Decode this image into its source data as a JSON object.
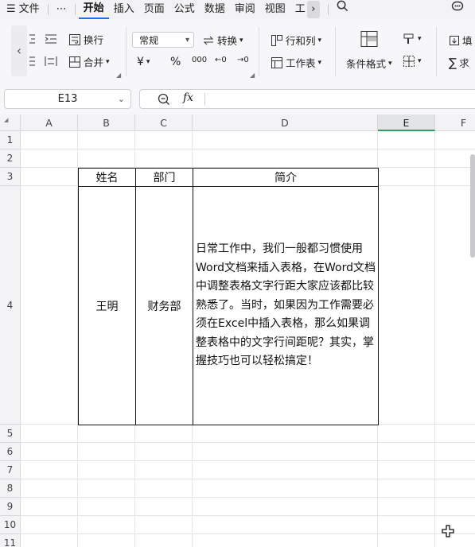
{
  "menu": {
    "items": [
      "文件",
      "开始",
      "插入",
      "页面",
      "公式",
      "数据",
      "审阅",
      "视图",
      "工"
    ],
    "active": "开始",
    "more": "⋯"
  },
  "ribbon": {
    "wrap_label": "换行",
    "merge_label": "合并",
    "number_format": "常规",
    "convert_label": "转换",
    "currency_symbol": "¥",
    "percent_symbol": "%",
    "thousands_symbol": "000",
    "dec_inc": "←0",
    "dec_dec": "→0",
    "rows_cols_label": "行和列",
    "sheet_label": "工作表",
    "cond_format_label": "条件格式",
    "fill_label": "填",
    "sum_label": "求"
  },
  "formula_bar": {
    "cell_ref": "E13",
    "fx": "fx",
    "value": ""
  },
  "sheet": {
    "columns": [
      "A",
      "B",
      "C",
      "D",
      "E",
      "F"
    ],
    "selected_column": "E",
    "rows": [
      "1",
      "2",
      "3",
      "4",
      "5",
      "6",
      "7",
      "8",
      "9",
      "10",
      "11"
    ],
    "table": {
      "headers": [
        "姓名",
        "部门",
        "简介"
      ],
      "name": "王明",
      "dept": "财务部",
      "intro": "日常工作中，我们一般都习惯使用Word文档来插入表格，在Word文档中调整表格文字行距大家应该都比较熟悉了。当时，如果因为工作需要必须在Excel中插入表格，那么如果调整表格中的文字行间距呢？其实，掌握技巧也可以轻松搞定！"
    }
  },
  "colors": {
    "accent": "#1a73e8",
    "selected_col_bar": "#2f9e61"
  }
}
